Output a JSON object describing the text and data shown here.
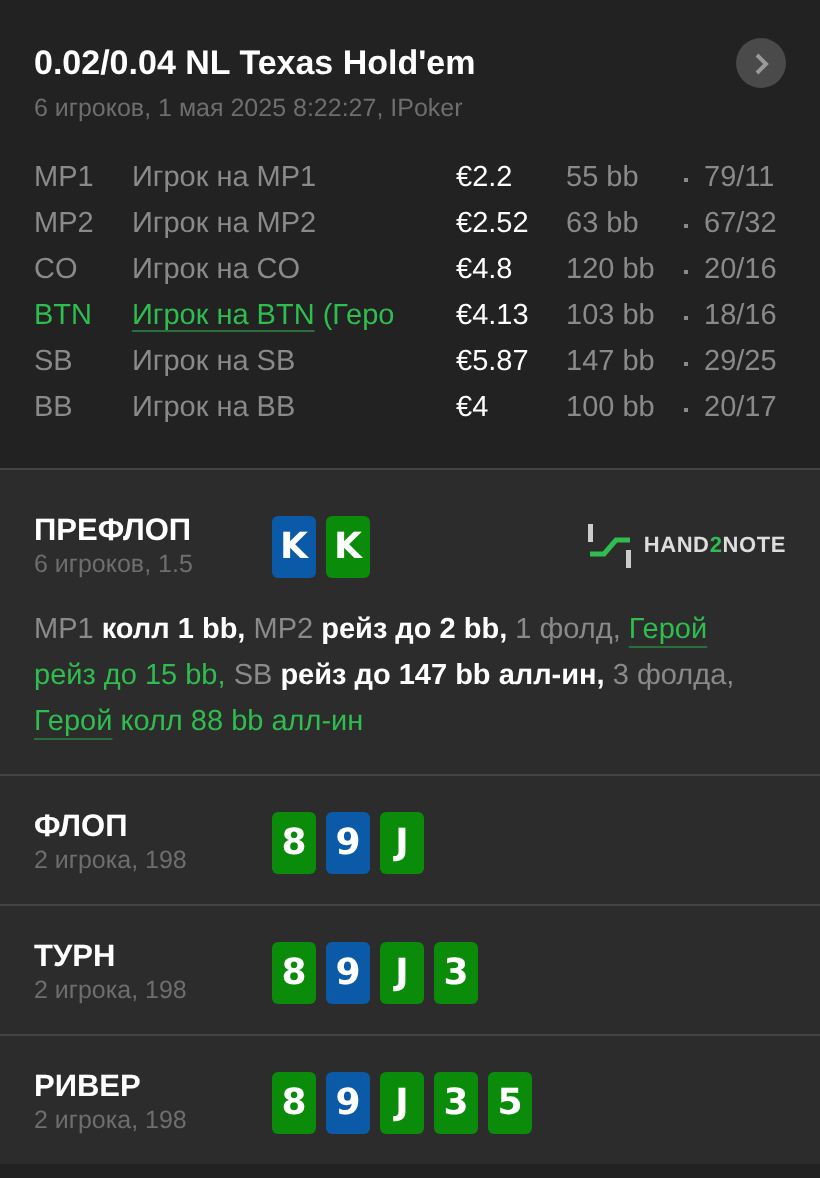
{
  "header": {
    "title": "0.02/0.04 NL Texas Hold'em",
    "subtitle": "6 игроков, 1 мая 2025 8:22:27, IPoker"
  },
  "players": [
    {
      "position": "MP1",
      "name": "Игрок на MP1",
      "stack": "€2.2",
      "bb": "55 bb",
      "stats": "79/11",
      "hero": false
    },
    {
      "position": "MP2",
      "name": "Игрок на MP2",
      "stack": "€2.52",
      "bb": "63 bb",
      "stats": "67/32",
      "hero": false
    },
    {
      "position": "CO",
      "name": "Игрок на CO",
      "stack": "€4.8",
      "bb": "120 bb",
      "stats": "20/16",
      "hero": false
    },
    {
      "position": "BTN",
      "name": "Игрок на BTN",
      "note": "(Геро",
      "stack": "€4.13",
      "bb": "103 bb",
      "stats": "18/16",
      "hero": true
    },
    {
      "position": "SB",
      "name": "Игрок на SB",
      "stack": "€5.87",
      "bb": "147 bb",
      "stats": "29/25",
      "hero": false
    },
    {
      "position": "BB",
      "name": "Игрок на BB",
      "stack": "€4",
      "bb": "100 bb",
      "stats": "20/17",
      "hero": false
    }
  ],
  "streets": [
    {
      "title": "ПРЕФЛОП",
      "subtitle": "6 игроков, 1.5",
      "cards": [
        {
          "rank": "K",
          "color": "#0a5aa8"
        },
        {
          "rank": "K",
          "color": "#0a8c0a"
        }
      ],
      "logo": {
        "prefix": "HAND",
        "digit": "2",
        "suffix": "NOTE"
      },
      "actions": [
        {
          "text": "MP1",
          "kind": "muted",
          "underline": false
        },
        {
          "text": "колл 1 bb,",
          "kind": "normal",
          "underline": false
        },
        {
          "text": "MP2",
          "kind": "muted",
          "underline": false
        },
        {
          "text": "рейз до 2 bb,",
          "kind": "normal",
          "underline": false
        },
        {
          "text": "1 фолд,",
          "kind": "muted",
          "underline": false
        },
        {
          "text": "Герой",
          "kind": "hero",
          "underline": true
        },
        {
          "text": "рейз до 15 bb,",
          "kind": "hero",
          "underline": false
        },
        {
          "text": "SB",
          "kind": "muted",
          "underline": false
        },
        {
          "text": "рейз до 147 bb алл-ин,",
          "kind": "normal",
          "underline": false
        },
        {
          "text": "3 фолда,",
          "kind": "muted",
          "underline": false
        },
        {
          "text": "Герой",
          "kind": "hero",
          "underline": true
        },
        {
          "text": "колл 88 bb алл-ин",
          "kind": "hero",
          "underline": false
        }
      ]
    },
    {
      "title": "ФЛОП",
      "subtitle": "2 игрока, 198",
      "cards": [
        {
          "rank": "8",
          "color": "#0a8c0a"
        },
        {
          "rank": "9",
          "color": "#0a5aa8"
        },
        {
          "rank": "J",
          "color": "#0a8c0a"
        }
      ]
    },
    {
      "title": "ТУРН",
      "subtitle": "2 игрока, 198",
      "cards": [
        {
          "rank": "8",
          "color": "#0a8c0a"
        },
        {
          "rank": "9",
          "color": "#0a5aa8"
        },
        {
          "rank": "J",
          "color": "#0a8c0a"
        },
        {
          "rank": "3",
          "color": "#0a8c0a"
        }
      ]
    },
    {
      "title": "РИВЕР",
      "subtitle": "2 игрока, 198",
      "cards": [
        {
          "rank": "8",
          "color": "#0a8c0a"
        },
        {
          "rank": "9",
          "color": "#0a5aa8"
        },
        {
          "rank": "J",
          "color": "#0a8c0a"
        },
        {
          "rank": "3",
          "color": "#0a8c0a"
        },
        {
          "rank": "5",
          "color": "#0a8c0a"
        }
      ]
    }
  ]
}
